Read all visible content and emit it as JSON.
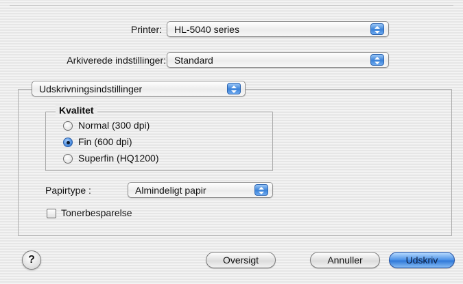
{
  "printer": {
    "label": "Printer:",
    "value": "HL-5040 series"
  },
  "presets": {
    "label": "Arkiverede indstillinger:",
    "value": "Standard"
  },
  "panel": {
    "value": "Udskrivningsindstillinger"
  },
  "quality": {
    "legend": "Kvalitet",
    "options": [
      "Normal (300 dpi)",
      "Fin (600 dpi)",
      "Superfin (HQ1200)"
    ],
    "selected": "Fin (600 dpi)"
  },
  "paper": {
    "label": "Papirtype :",
    "value": "Almindeligt papir"
  },
  "toner": {
    "label": "Tonerbesparelse",
    "checked": false
  },
  "buttons": {
    "help": "?",
    "preview": "Oversigt",
    "cancel": "Annuller",
    "print": "Udskriv"
  },
  "colors": {
    "accent": "#3b82d8",
    "background": "#ececec"
  }
}
